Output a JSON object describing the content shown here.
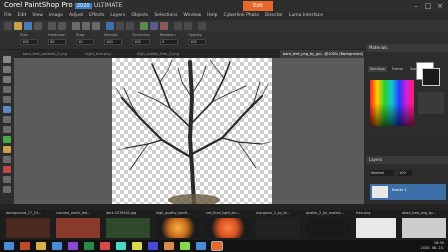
{
  "app": {
    "brand": "Corel PaintShop Pro",
    "version": "2020",
    "edition": "ULTIMATE",
    "tab_active": "Edit"
  },
  "menu": [
    "File",
    "Edit",
    "View",
    "Image",
    "Adjust",
    "Effects",
    "Layers",
    "Objects",
    "Selections",
    "Window",
    "Help",
    "Cyberlink Photo",
    "Director",
    "Luma Interface"
  ],
  "options": [
    {
      "label": "Size:",
      "value": "100"
    },
    {
      "label": "Hardness:",
      "value": "50"
    },
    {
      "label": "Step:",
      "value": "10"
    },
    {
      "label": "Density:",
      "value": "100"
    },
    {
      "label": "Thickness:",
      "value": "100"
    },
    {
      "label": "Rotation:",
      "value": "0"
    },
    {
      "label": "Opacity:",
      "value": "100"
    }
  ],
  "doc_tabs": [
    {
      "label": "bare_tree_isolated_2.png"
    },
    {
      "label": "night_tree.png"
    },
    {
      "label": "high_quality_tree_2.png"
    },
    {
      "label": "bare_tree_png_by_gui...@100% (Background)",
      "active": true
    }
  ],
  "materials": {
    "title": "Materials",
    "tabs": [
      "Rainbow",
      "Frame",
      "Swatches"
    ],
    "foreground": "#1a1a1a",
    "background": "#ffffff"
  },
  "layers": {
    "title": "Layers",
    "blend": "Normal",
    "opacity": "100",
    "row": "Raster 1"
  },
  "filmstrip": [
    {
      "label": "background_17_15...",
      "color": "#4a2a20"
    },
    {
      "label": "cracked_earth_red...",
      "color": "#8a3a2a"
    },
    {
      "label": "dark-3378542.jpg",
      "color": "#2e4a2a"
    },
    {
      "label": "high_quality_bonfi...",
      "color": "#c06a1a"
    },
    {
      "label": "red_fluid_light_sm...",
      "color": "#d05020"
    },
    {
      "label": "morgaine_1_by_fo...",
      "color": "#222222"
    },
    {
      "label": "quaklo_2_by_markle...",
      "color": "#1a1a1a"
    },
    {
      "label": "tree.png",
      "color": "#e8e8e8"
    },
    {
      "label": "dead_tree_png_by...",
      "color": "#cccccc"
    }
  ],
  "clock": {
    "time": "16:35",
    "date": "2020. 08. 23."
  },
  "colors": {
    "accent": "#e8682c",
    "selection": "#3d6fa8"
  }
}
